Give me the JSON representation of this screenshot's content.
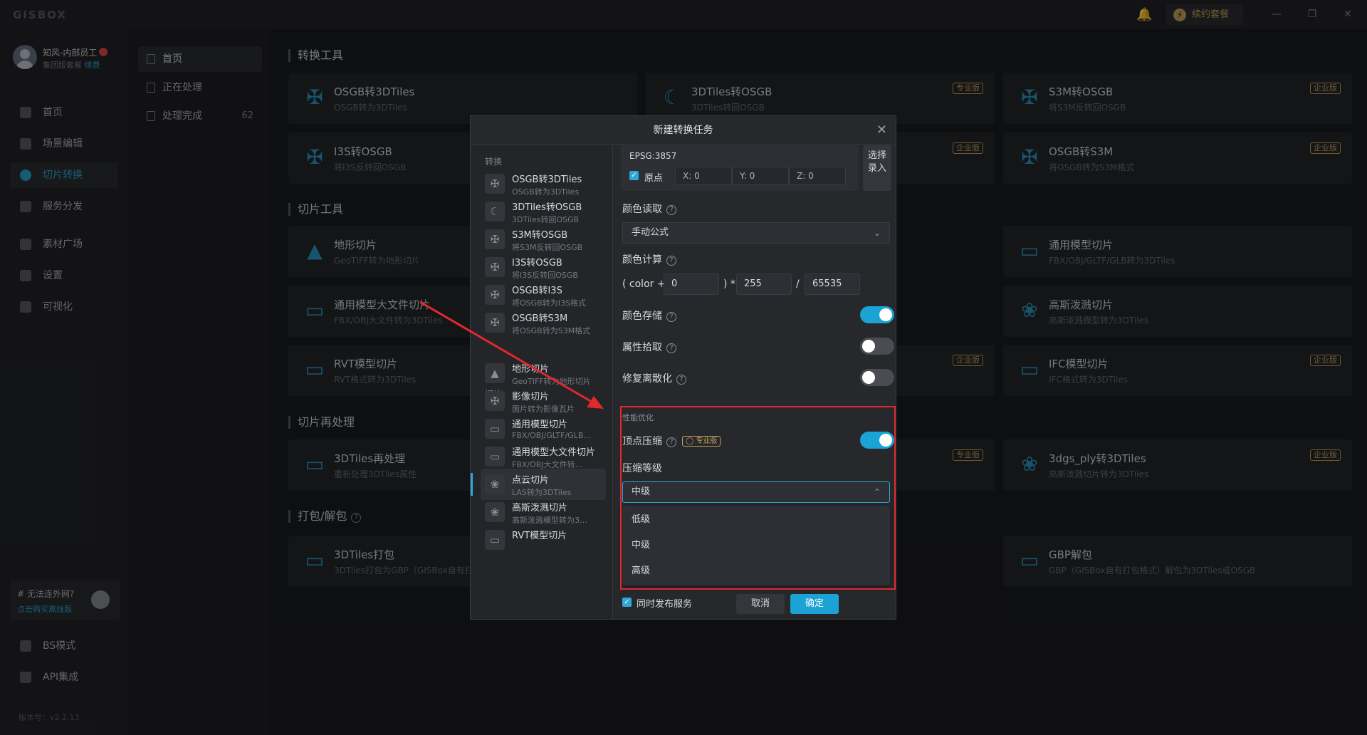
{
  "app": {
    "logo": "GISBOX",
    "renew": "续约套餐"
  },
  "user": {
    "name": "知风-内部员工",
    "plan": "集团版套餐",
    "renew_link": "续费"
  },
  "sidebar": {
    "items": [
      {
        "label": "首页"
      },
      {
        "label": "场景编辑"
      },
      {
        "label": "切片转换"
      },
      {
        "label": "服务分发"
      },
      {
        "label": "素材广场"
      },
      {
        "label": "设置"
      },
      {
        "label": "可视化"
      }
    ],
    "offline_title": "# 无法连外网?",
    "offline_link": "点击购买离线版",
    "bs_mode": "BS模式",
    "api": "API集成",
    "version": "版本号：v2.2.13"
  },
  "subnav": {
    "items": [
      {
        "label": "首页"
      },
      {
        "label": "正在处理"
      },
      {
        "label": "处理完成",
        "count": "62"
      }
    ]
  },
  "sections": {
    "convert": "转换工具",
    "tile": "切片工具",
    "reprocess": "切片再处理",
    "pack": "打包/解包"
  },
  "cards": [
    {
      "title": "OSGB转3DTiles",
      "sub": "OSGB转为3DTiles",
      "badge": ""
    },
    {
      "title": "3DTiles转OSGB",
      "sub": "3DTiles转回OSGB",
      "badge": "专业版"
    },
    {
      "title": "S3M转OSGB",
      "sub": "将S3M反转回OSGB",
      "badge": "企业版"
    },
    {
      "title": "I3S转OSGB",
      "sub": "将I3S反转回OSGB",
      "badge": ""
    },
    {
      "title": "",
      "sub": "",
      "badge": "企业版"
    },
    {
      "title": "OSGB转S3M",
      "sub": "将OSGB转为S3M格式",
      "badge": "企业版"
    },
    {
      "title": "地形切片",
      "sub": "GeoTIFF转为地形切片",
      "badge": ""
    },
    {
      "title": "通用模型切片",
      "sub": "FBX/OBJ/GLTF/GLB转为3DTiles",
      "badge": ""
    },
    {
      "title": "通用模型大文件切片",
      "sub": "FBX/OBJ大文件转为3DTiles",
      "badge": ""
    },
    {
      "title": "高斯泼溅切片",
      "sub": "高斯泼溅模型转为3DTiles",
      "badge": ""
    },
    {
      "title": "RVT模型切片",
      "sub": "RVT格式转为3DTiles",
      "badge": ""
    },
    {
      "title": "",
      "sub": "",
      "badge": "企业版"
    },
    {
      "title": "IFC模型切片",
      "sub": "IFC格式转为3DTiles",
      "badge": "企业版"
    },
    {
      "title": "3DTiles再处理",
      "sub": "重新处理3DTiles属性",
      "badge": ""
    },
    {
      "title": "",
      "sub": "",
      "badge": "专业版"
    },
    {
      "title": "3dgs_ply转3DTiles",
      "sub": "高斯泼溅切片转为3DTiles",
      "badge": "企业版"
    },
    {
      "title": "3DTiles打包",
      "sub": "3DTiles打包为GBP（GISBox自有打",
      "badge": ""
    },
    {
      "title": "GBP解包",
      "sub": "GBP（GISBox自有打包格式）解包为3DTiles或OSGB",
      "badge": ""
    }
  ],
  "modal": {
    "title": "新建转换任务",
    "group_convert": "转换",
    "group_tile": "切片",
    "list": [
      {
        "title": "OSGB转3DTiles",
        "sub": "OSGB转为3DTiles"
      },
      {
        "title": "3DTiles转OSGB",
        "sub": "3DTiles转回OSGB"
      },
      {
        "title": "S3M转OSGB",
        "sub": "将S3M反转回OSGB"
      },
      {
        "title": "I3S转OSGB",
        "sub": "将I3S反转回OSGB"
      },
      {
        "title": "OSGB转I3S",
        "sub": "将OSGB转为I3S格式"
      },
      {
        "title": "OSGB转S3M",
        "sub": "将OSGB转为S3M格式"
      },
      {
        "title": "地形切片",
        "sub": "GeoTIFF转为地形切片"
      },
      {
        "title": "影像切片",
        "sub": "图片转为影像瓦片"
      },
      {
        "title": "通用模型切片",
        "sub": "FBX/OBJ/GLTF/GLB…"
      },
      {
        "title": "通用模型大文件切片",
        "sub": "FBX/OBJ大文件转…"
      },
      {
        "title": "点云切片",
        "sub": "LAS转为3DTiles"
      },
      {
        "title": "高斯泼溅切片",
        "sub": "高斯泼溅模型转为3…"
      },
      {
        "title": "RVT模型切片",
        "sub": ""
      }
    ],
    "epsg": "EPSG:3857",
    "origin": "原点",
    "x": "X: 0",
    "y": "Y: 0",
    "z": "Z: 0",
    "select_import_1": "选择",
    "select_import_2": "录入",
    "color_read": "颜色读取",
    "color_read_value": "手动公式",
    "color_calc": "颜色计算",
    "calc_prefix": "( color +",
    "calc_add": "0",
    "calc_mul_sym": ") *",
    "calc_mul": "255",
    "calc_div_sym": "/",
    "calc_div": "65535",
    "color_store": "颜色存储",
    "attr_pick": "属性拾取",
    "repair_discrete": "修复离散化",
    "perf": "性能优化",
    "vertex_compress": "顶点压缩",
    "pro_badge": "专业版",
    "compress_level": "压缩等级",
    "compress_value": "中级",
    "options": [
      "低级",
      "中级",
      "高级"
    ],
    "publish": "同时发布服务",
    "cancel": "取消",
    "ok": "确定",
    "toggles": {
      "color_store": true,
      "attr_pick": false,
      "repair_discrete": false,
      "vertex_compress": true
    }
  }
}
